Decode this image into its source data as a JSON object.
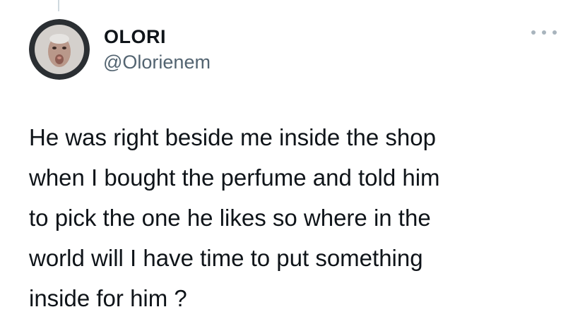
{
  "tweet": {
    "author": {
      "display_name": "OLORI",
      "handle": "@Olorienem",
      "avatar_icon": "avatar-face-icon"
    },
    "more_icon": "more-options-icon",
    "text": "He was right beside me inside the shop\nwhen I bought the perfume and told him\nto pick the one he likes so where in the\nworld will I have time to put something\ninside for him ?"
  },
  "colors": {
    "text_primary": "#0f1419",
    "text_secondary": "#536471",
    "thread_line": "#cfd9de",
    "avatar_ring": "#2b2f33"
  }
}
